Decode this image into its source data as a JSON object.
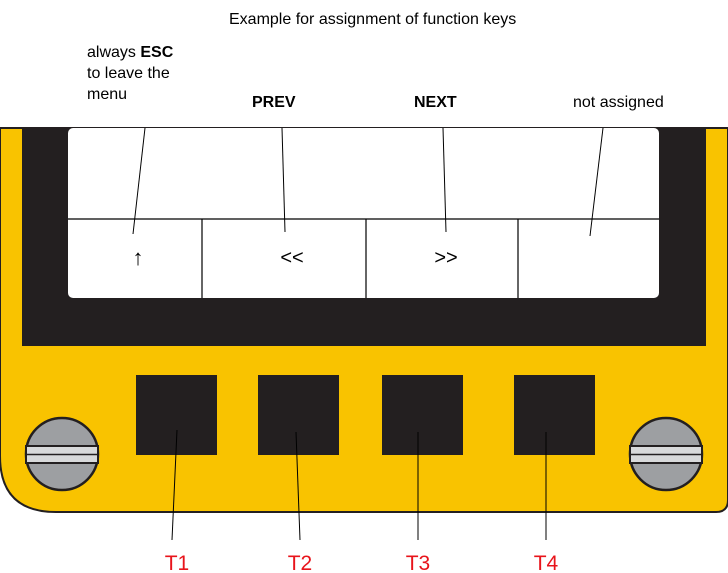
{
  "title": "Example for assignment of function keys",
  "annotations": {
    "esc_line1_prefix": "always ",
    "esc_line1_bold": "ESC",
    "esc_line2": "to leave the",
    "esc_line3": "menu",
    "prev": "PREV",
    "next": "NEXT",
    "not_assigned": "not assigned"
  },
  "display": {
    "softkeys": [
      "↑",
      "<<",
      ">>",
      ""
    ]
  },
  "keys": [
    "T1",
    "T2",
    "T3",
    "T4"
  ],
  "colors": {
    "housing": "#f9c300",
    "bezel": "#231f20",
    "screen": "#ffffff",
    "key": "#231f20",
    "key_label": "#e8141b",
    "screw": "#9d9fa2"
  },
  "icons": {
    "screw": "slotted-screw-icon",
    "esc_arrow": "up-arrow-icon"
  }
}
